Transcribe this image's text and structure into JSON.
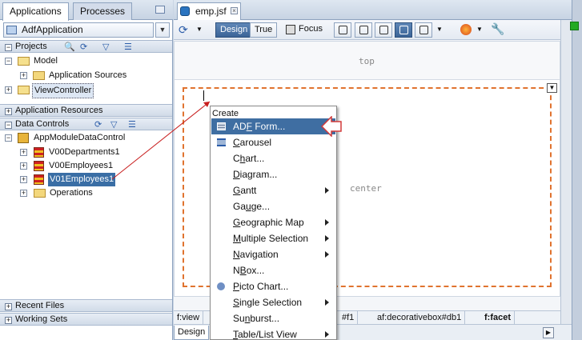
{
  "left_panel": {
    "tabs": [
      "Applications",
      "Processes"
    ],
    "app_selector": "AdfApplication",
    "sections": {
      "projects": "Projects",
      "application_resources": "Application Resources",
      "data_controls": "Data Controls",
      "recent_files": "Recent Files",
      "working_sets": "Working Sets"
    },
    "projects_tree": [
      "Model",
      "Application Sources",
      "ViewController"
    ],
    "data_controls_tree": [
      "AppModuleDataControl",
      "V00Departments1",
      "V00Employees1",
      "V01Employees1",
      "Operations"
    ]
  },
  "editor": {
    "tab_title": "emp.jsf",
    "toolbar": {
      "design": "Design",
      "true": "True",
      "focus": "Focus"
    },
    "zones": {
      "top": "top",
      "center": "center"
    },
    "breadcrumbs": [
      "f:view",
      "#f1",
      "af:decorativebox#db1",
      "f:facet"
    ],
    "bottom_tab": "Design"
  },
  "context_menu": {
    "header": "Create",
    "items": [
      {
        "label": "ADF Form...",
        "mnemonic": "F",
        "submenu": false,
        "highlighted": true
      },
      {
        "label": "Carousel",
        "mnemonic": "C",
        "submenu": false
      },
      {
        "label": "Chart...",
        "mnemonic": "h",
        "submenu": false
      },
      {
        "label": "Diagram...",
        "mnemonic": "D",
        "submenu": false
      },
      {
        "label": "Gantt",
        "mnemonic": "G",
        "submenu": true
      },
      {
        "label": "Gauge...",
        "mnemonic": "u",
        "submenu": false
      },
      {
        "label": "Geographic Map",
        "mnemonic": "G",
        "submenu": true
      },
      {
        "label": "Multiple Selection",
        "mnemonic": "M",
        "submenu": true
      },
      {
        "label": "Navigation",
        "mnemonic": "N",
        "submenu": true
      },
      {
        "label": "NBox...",
        "mnemonic": "B",
        "submenu": false
      },
      {
        "label": "Picto Chart...",
        "mnemonic": "P",
        "submenu": false
      },
      {
        "label": "Single Selection",
        "mnemonic": "S",
        "submenu": true
      },
      {
        "label": "Sunburst...",
        "mnemonic": "n",
        "submenu": false
      },
      {
        "label": "Table/List View",
        "mnemonic": "T",
        "submenu": true
      }
    ]
  },
  "colors": {
    "selection": "#3a6ea5",
    "menu_highlight": "#3f6ea2",
    "facet_border": "#e0732f",
    "drag_line": "#c81e1e"
  }
}
